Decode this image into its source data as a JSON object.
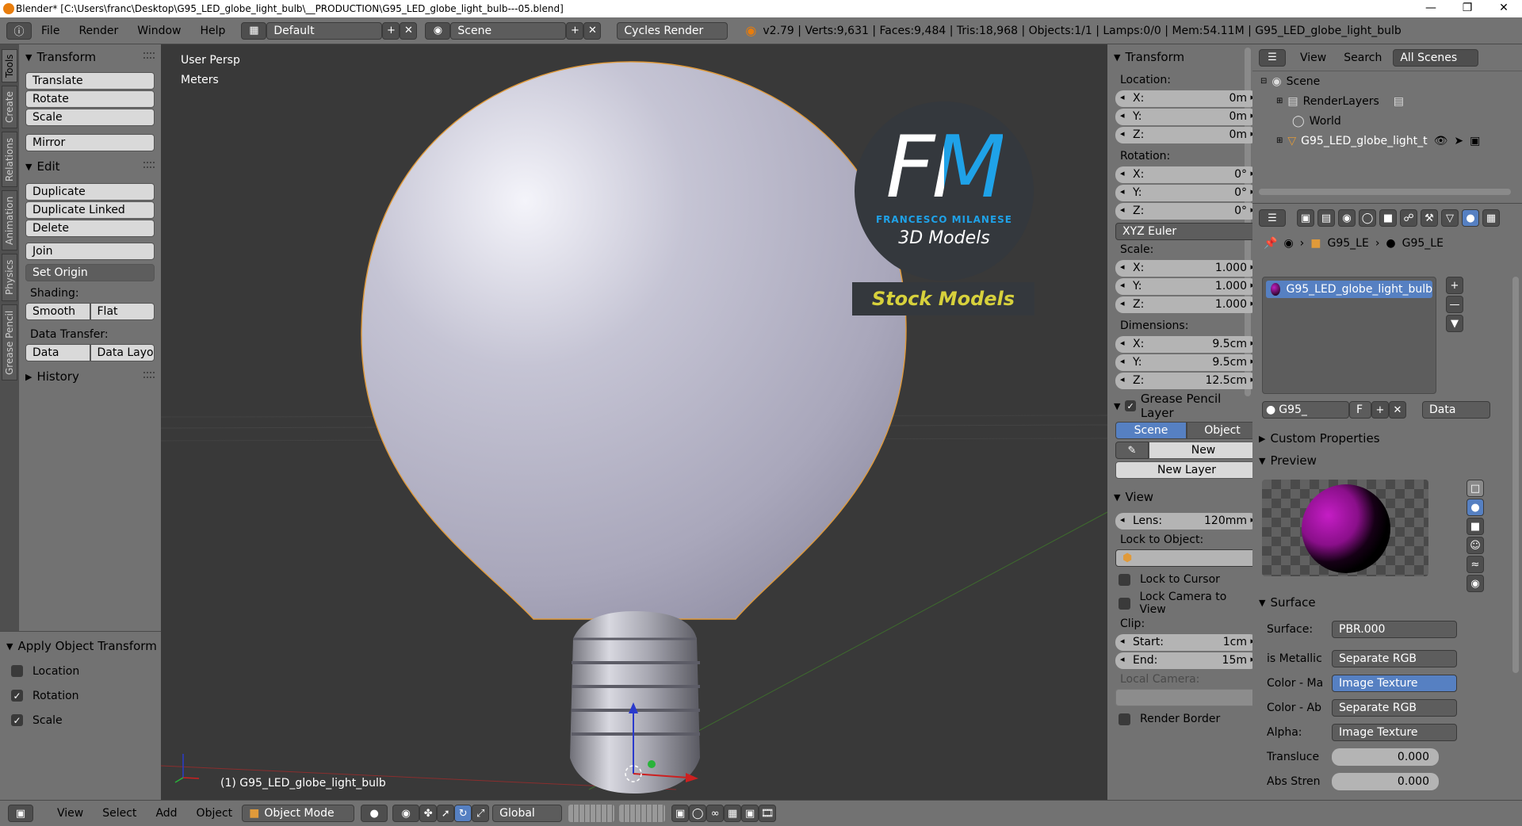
{
  "window": {
    "title": "Blender* [C:\\Users\\franc\\Desktop\\G95_LED_globe_light_bulb\\__PRODUCTION\\G95_LED_globe_light_bulb---05.blend]"
  },
  "menu": {
    "file": "File",
    "render": "Render",
    "window": "Window",
    "help": "Help"
  },
  "layout": {
    "screen": "Default",
    "scene": "Scene",
    "engine": "Cycles Render"
  },
  "stats": "v2.79 | Verts:9,631 | Faces:9,484 | Tris:18,968 | Objects:1/1 | Lamps:0/0 | Mem:54.11M | G95_LED_globe_light_bulb",
  "tabs": [
    "Tools",
    "Create",
    "Relations",
    "Animation",
    "Physics",
    "Grease Pencil"
  ],
  "tools": {
    "transform_title": "Transform",
    "translate": "Translate",
    "rotate": "Rotate",
    "scale": "Scale",
    "mirror": "Mirror",
    "edit_title": "Edit",
    "duplicate": "Duplicate",
    "duplicate_linked": "Duplicate Linked",
    "delete": "Delete",
    "join": "Join",
    "set_origin": "Set Origin",
    "shading_label": "Shading:",
    "smooth": "Smooth",
    "flat": "Flat",
    "data_transfer_label": "Data Transfer:",
    "data": "Data",
    "data_layout": "Data Layo",
    "history": "History"
  },
  "operator": {
    "title": "Apply Object Transform",
    "location": "Location",
    "rotation": "Rotation",
    "scale": "Scale",
    "location_checked": false,
    "rotation_checked": true,
    "scale_checked": true
  },
  "viewport": {
    "view_name": "User Persp",
    "units": "Meters",
    "object_label": "(1) G95_LED_globe_light_bulb",
    "logo_fm": "FM",
    "logo_name": "FRANCESCO MILANESE",
    "logo_sub": "3D Models",
    "logo_stock": "Stock Models"
  },
  "npanel": {
    "transform_title": "Transform",
    "location_label": "Location:",
    "loc": [
      [
        "X:",
        "0m"
      ],
      [
        "Y:",
        "0m"
      ],
      [
        "Z:",
        "0m"
      ]
    ],
    "rotation_label": "Rotation:",
    "rot": [
      [
        "X:",
        "0°"
      ],
      [
        "Y:",
        "0°"
      ],
      [
        "Z:",
        "0°"
      ]
    ],
    "rotation_mode": "XYZ Euler",
    "scale_label": "Scale:",
    "scl": [
      [
        "X:",
        "1.000"
      ],
      [
        "Y:",
        "1.000"
      ],
      [
        "Z:",
        "1.000"
      ]
    ],
    "dimensions_label": "Dimensions:",
    "dim": [
      [
        "X:",
        "9.5cm"
      ],
      [
        "Y:",
        "9.5cm"
      ],
      [
        "Z:",
        "12.5cm"
      ]
    ],
    "gp_title": "Grease Pencil Layer",
    "gp_scene": "Scene",
    "gp_object": "Object",
    "gp_new": "New",
    "gp_new_layer": "New Layer",
    "view_title": "View",
    "lens_label": "Lens:",
    "lens_value": "120mm",
    "lock_object_label": "Lock to Object:",
    "lock_cursor": "Lock to Cursor",
    "lock_camera": "Lock Camera to View",
    "clip_label": "Clip:",
    "clip_start_label": "Start:",
    "clip_start": "1cm",
    "clip_end_label": "End:",
    "clip_end": "15m",
    "local_camera": "Local Camera:",
    "render_border": "Render Border"
  },
  "outliner": {
    "view": "View",
    "search": "Search",
    "all_scenes": "All Scenes",
    "scene": "Scene",
    "render_layers": "RenderLayers",
    "world": "World",
    "object": "G95_LED_globe_light_t"
  },
  "properties": {
    "crumb1": "G95_LE",
    "crumb2": "G95_LE",
    "material_slot": "G95_LED_globe_light_bulb",
    "mat_name": "G95_",
    "mat_f": "F",
    "data_select": "Data",
    "custom_props": "Custom Properties",
    "preview": "Preview",
    "surface_title": "Surface",
    "surface_label": "Surface:",
    "surface_value": "PBR.000",
    "inputs": [
      {
        "label": "is Metallic",
        "value": "Separate RGB",
        "selected": false
      },
      {
        "label": "Color - Ma",
        "value": "Image Texture",
        "selected": true
      },
      {
        "label": "Color - Ab",
        "value": "Separate RGB",
        "selected": false
      },
      {
        "label": "Alpha:",
        "value": "Image Texture",
        "selected": false
      }
    ],
    "transluce_label": "Transluce",
    "transluce_value": "0.000",
    "abs_label": "Abs Stren",
    "abs_value": "0.000"
  },
  "bottombar": {
    "view": "View",
    "select": "Select",
    "add": "Add",
    "object": "Object",
    "mode": "Object Mode",
    "orientation": "Global"
  },
  "colors": {
    "accent": "#5680c2",
    "selected_outline": "#e09a3a",
    "panel": "#727272",
    "viewport": "#393939"
  }
}
